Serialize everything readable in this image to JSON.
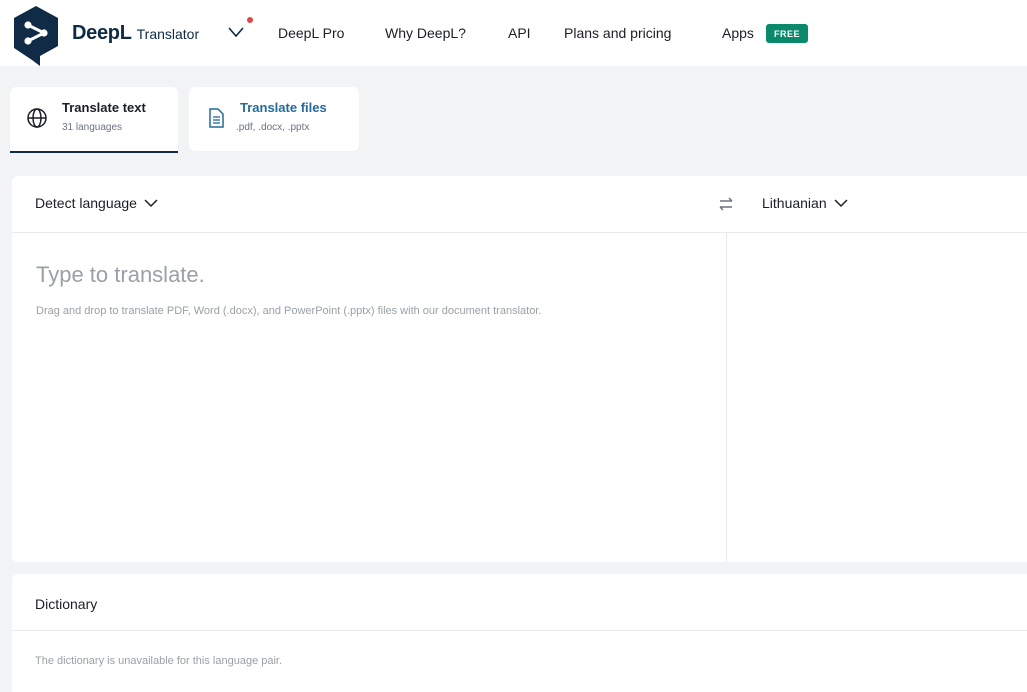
{
  "header": {
    "brand_name": "DeepL",
    "brand_sub": "Translator",
    "nav": [
      "DeepL Pro",
      "Why DeepL?",
      "API",
      "Plans and pricing",
      "Apps"
    ],
    "free_badge": "FREE",
    "brand_color": "#0f2b46",
    "badge_color": "#0b8a6b",
    "notification_color": "#e04848"
  },
  "tabs": [
    {
      "title": "Translate text",
      "subtitle": "31 languages",
      "icon": "globe-icon",
      "active": true
    },
    {
      "title": "Translate files",
      "subtitle": ".pdf, .docx, .pptx",
      "icon": "document-icon",
      "active": false
    }
  ],
  "translator": {
    "source_language": "Detect language",
    "target_language": "Lithuanian",
    "placeholder": "Type to translate.",
    "hint": "Drag and drop to translate PDF, Word (.docx), and PowerPoint (.pptx) files with our document translator."
  },
  "dictionary": {
    "title": "Dictionary",
    "message": "The dictionary is unavailable for this language pair."
  }
}
